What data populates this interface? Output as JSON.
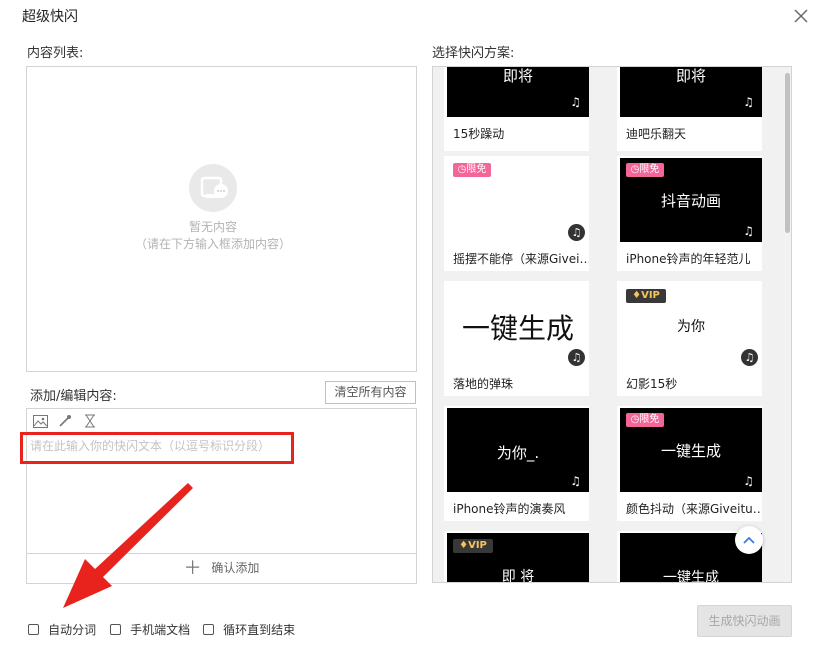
{
  "dialog": {
    "title": "超级快闪",
    "close_icon": "close-icon"
  },
  "content_list": {
    "label": "内容列表:",
    "empty_title": "暂无内容",
    "empty_hint": "（请在下方输入框添加内容）",
    "empty_icon": "empty-content-icon"
  },
  "edit": {
    "label": "添加/编辑内容:",
    "clear_label": "清空所有内容",
    "tools": [
      "image-icon",
      "eyedropper-icon",
      "hourglass-icon"
    ],
    "placeholder": "请在此输入你的快闪文本（以逗号标识分段）",
    "confirm_label": "确认添加",
    "confirm_icon": "plus-icon"
  },
  "schemes": {
    "label": "选择快闪方案:",
    "items": [
      {
        "name": "15秒躁动",
        "thumb_text": "即将",
        "badge": ""
      },
      {
        "name": "迪吧乐翻天",
        "thumb_text": "即将",
        "badge": ""
      },
      {
        "name": "摇摆不能停（来源Givei…",
        "thumb_text": "",
        "badge": "限免"
      },
      {
        "name": "iPhone铃声的年轻范儿",
        "thumb_text": "抖音动画",
        "badge": "限免"
      },
      {
        "name": "落地的弹珠",
        "thumb_text": "一键生成",
        "badge": ""
      },
      {
        "name": "幻影15秒",
        "thumb_text": "为你",
        "badge": "VIP"
      },
      {
        "name": "iPhone铃声的演奏风",
        "thumb_text": "为你_.",
        "badge": ""
      },
      {
        "name": "颜色抖动（来源Giveitu…",
        "thumb_text": "一键生成",
        "badge": "限免"
      },
      {
        "name": "",
        "thumb_text": "即 将",
        "badge": "VIP"
      },
      {
        "name": "",
        "thumb_text": "一键生成",
        "badge": ""
      }
    ],
    "back_to_top_icon": "chevron-up-icon",
    "music_icon": "music-note-icon"
  },
  "options": {
    "auto_split": {
      "label": "自动分词",
      "checked": false
    },
    "mobile_doc": {
      "label": "手机端文档",
      "checked": false
    },
    "loop": {
      "label": "循环直到结束",
      "checked": false
    }
  },
  "generate_label": "生成快闪动画",
  "annotation": {
    "color": "#e8231e"
  }
}
